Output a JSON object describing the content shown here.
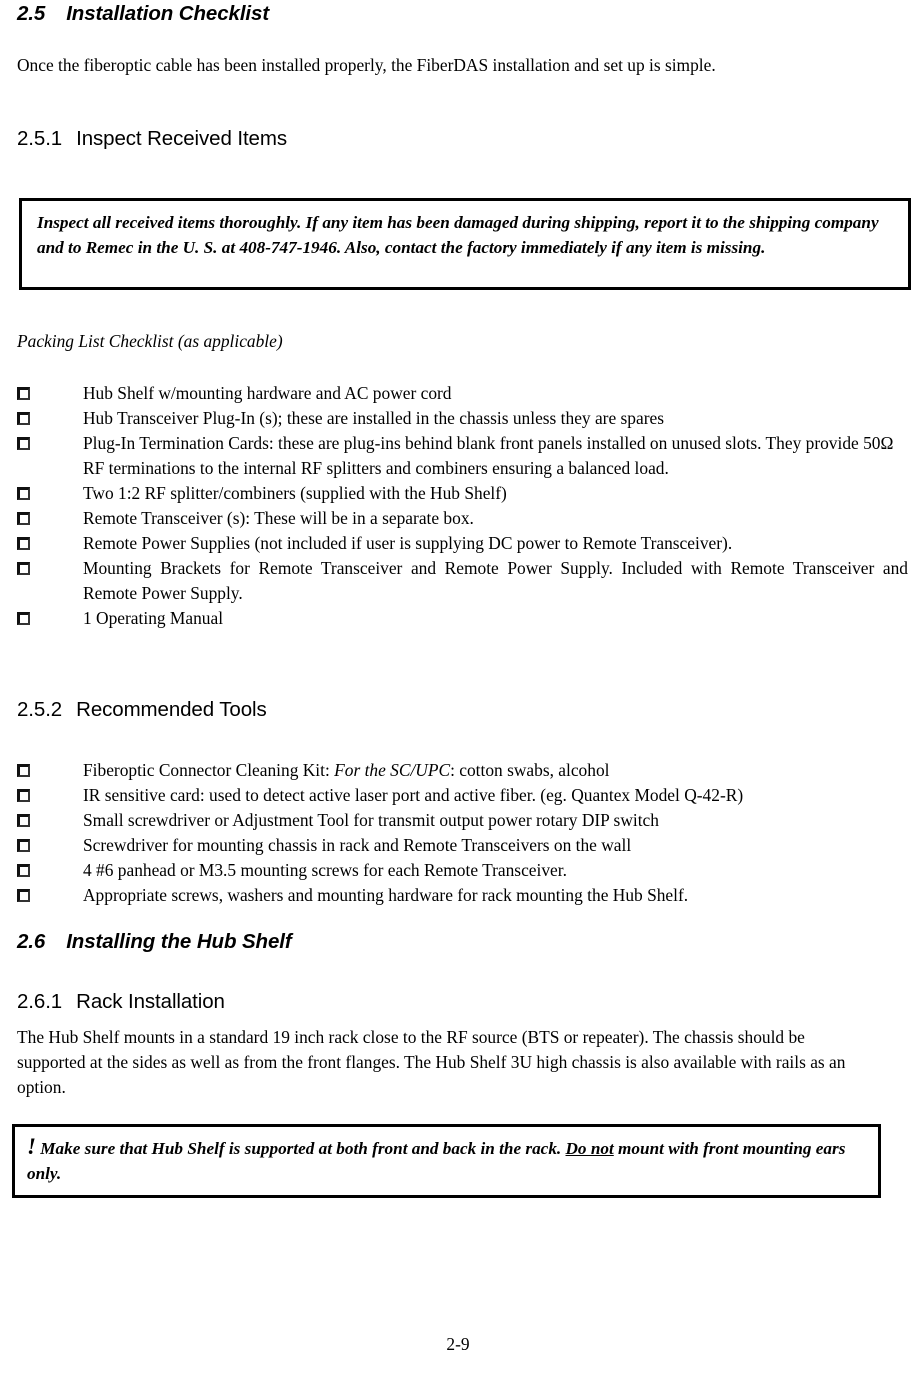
{
  "document": {
    "section_2_5": {
      "number": "2.5",
      "title": "Installation Checklist",
      "intro": "Once the fiberoptic cable has been installed properly, the FiberDAS installation and set up is simple."
    },
    "section_2_5_1": {
      "number": "2.5.1",
      "title": "Inspect Received Items",
      "notice": "Inspect all received items thoroughly. If any item has been damaged during shipping, report it to the shipping company and to Remec in the U. S. at 408-747-1946.  Also, contact the factory immediately if any item is missing.",
      "list_caption": "Packing List Checklist (as applicable)",
      "items": [
        {
          "text": "Hub Shelf w/mounting hardware and AC power cord"
        },
        {
          "text": "Hub Transceiver Plug-In (s); these are installed in the chassis unless they are spares"
        },
        {
          "text": "Plug-In Termination Cards: these are plug-ins behind blank front panels installed on unused slots. They provide 50Ω RF terminations to the internal RF splitters and combiners ensuring a balanced load."
        },
        {
          "text": "Two 1:2 RF splitter/combiners (supplied with the Hub Shelf)"
        },
        {
          "text": "Remote Transceiver (s): These will be in a separate box."
        },
        {
          "text": "Remote Power Supplies (not included if user is supplying DC power to Remote Transceiver)."
        },
        {
          "text": "Mounting Brackets for Remote Transceiver and Remote Power Supply. Included with Remote Transceiver and Remote Power Supply.",
          "justify": true
        },
        {
          "text": "1 Operating Manual"
        }
      ]
    },
    "section_2_5_2": {
      "number": "2.5.2",
      "title": "Recommended Tools",
      "items": [
        {
          "prefix": "Fiberoptic Connector Cleaning Kit: ",
          "italic": "For the SC/UPC",
          "suffix": ": cotton swabs, alcohol"
        },
        {
          "text": "IR sensitive card: used to detect active laser port and active fiber. (eg. Quantex  Model Q-42-R)"
        },
        {
          "text": "Small screwdriver or Adjustment Tool for transmit output power rotary DIP switch"
        },
        {
          "text": "Screwdriver for mounting chassis in rack and Remote Transceivers on the wall"
        },
        {
          "text": "4 #6 panhead or M3.5 mounting screws for each Remote Transceiver."
        },
        {
          "text": "Appropriate screws, washers and mounting hardware for rack mounting the Hub Shelf."
        }
      ]
    },
    "section_2_6": {
      "number": "2.6",
      "title": "Installing the Hub Shelf"
    },
    "section_2_6_1": {
      "number": "2.6.1",
      "title": "Rack Installation",
      "body": "The Hub Shelf mounts in a standard 19 inch rack close to the RF source (BTS or repeater). The chassis should be supported at the sides as well as from the front flanges. The Hub Shelf 3U high chassis is also available with rails as an option.",
      "warning": {
        "mark": "!",
        "before": " Make sure that Hub Shelf is supported at both front and back in the rack. ",
        "emphasis": "Do not",
        "after": " mount with front mounting ears only."
      }
    },
    "footer": {
      "page_number": "2-9"
    }
  }
}
